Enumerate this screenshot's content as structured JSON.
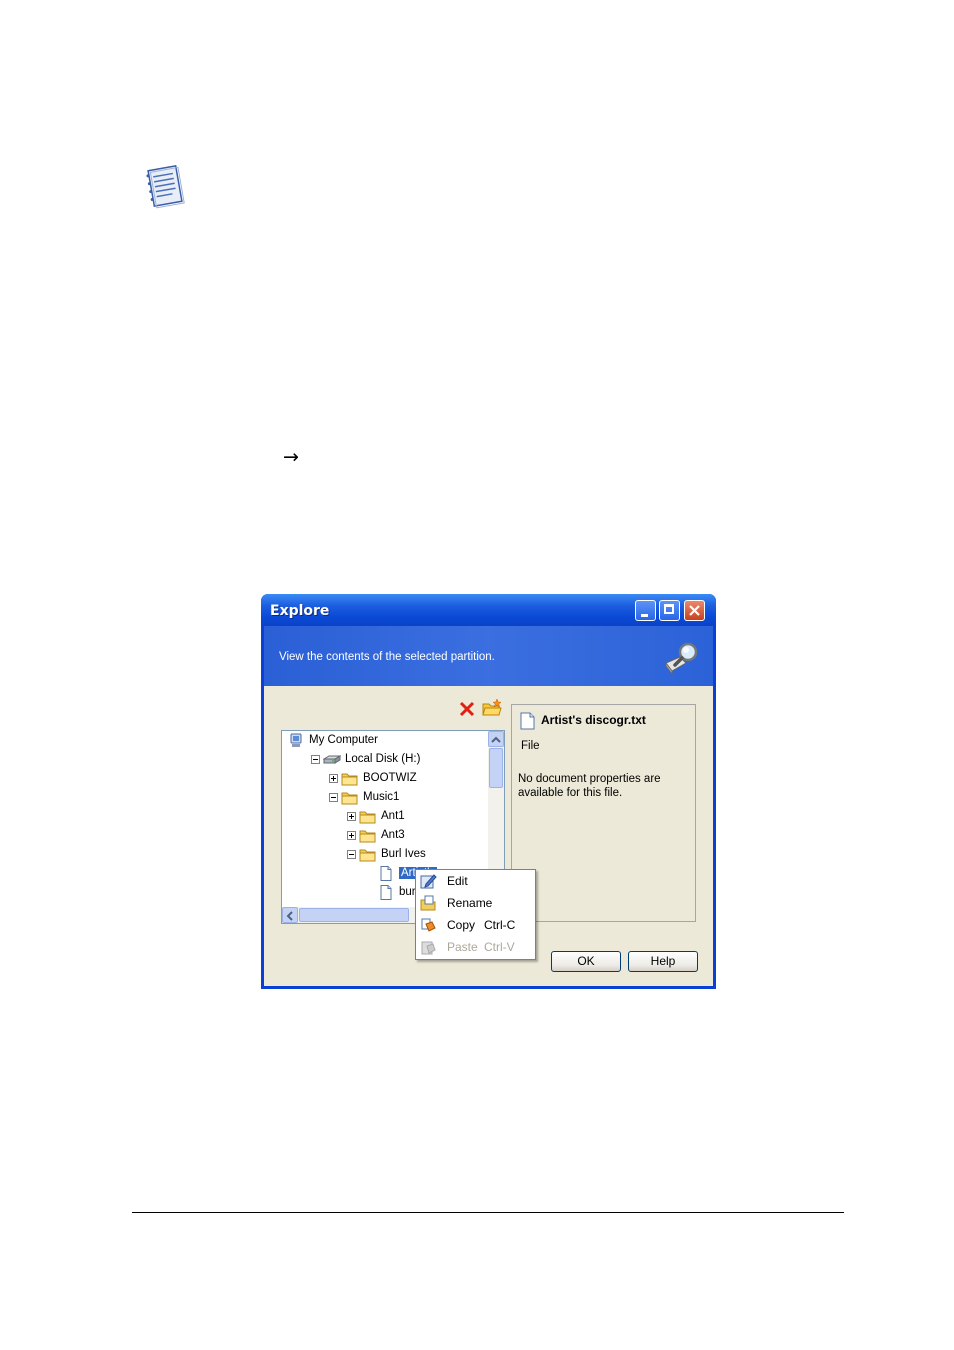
{
  "page": {
    "arrow_glyph": "→"
  },
  "dialog": {
    "title": "Explore",
    "header_text": "View the contents of the selected partition.",
    "tree": [
      {
        "label": "My Computer",
        "indent": 0,
        "expander": "none",
        "icon": "computer-icon"
      },
      {
        "label": "Local Disk (H:)",
        "indent": 1,
        "expander": "minus",
        "icon": "drive-icon"
      },
      {
        "label": "BOOTWIZ",
        "indent": 2,
        "expander": "plus",
        "icon": "folder-icon"
      },
      {
        "label": "Music1",
        "indent": 2,
        "expander": "minus",
        "icon": "folder-icon"
      },
      {
        "label": "Ant1",
        "indent": 3,
        "expander": "plus",
        "icon": "folder-icon"
      },
      {
        "label": "Ant3",
        "indent": 3,
        "expander": "plus",
        "icon": "folder-icon"
      },
      {
        "label": "Burl Ives",
        "indent": 3,
        "expander": "minus",
        "icon": "folder-icon"
      },
      {
        "label": "Artist's",
        "indent": 4,
        "expander": "none",
        "icon": "file-icon",
        "selected": true
      },
      {
        "label": "burl iv",
        "indent": 4,
        "expander": "none",
        "icon": "file-icon"
      }
    ],
    "properties": {
      "name": "Artist's discogr.txt",
      "type": "File",
      "description": "No document properties are available for this file."
    },
    "buttons": {
      "ok": "OK",
      "help": "Help"
    }
  },
  "context_menu": {
    "items": [
      {
        "label": "Edit",
        "shortcut": "",
        "icon": "edit-icon",
        "enabled": true
      },
      {
        "label": "Rename",
        "shortcut": "",
        "icon": "rename-icon",
        "enabled": true
      },
      {
        "label": "Copy",
        "shortcut": "Ctrl-C",
        "icon": "copy-icon",
        "enabled": true
      },
      {
        "label": "Paste",
        "shortcut": "Ctrl-V",
        "icon": "paste-icon",
        "enabled": false
      }
    ]
  }
}
